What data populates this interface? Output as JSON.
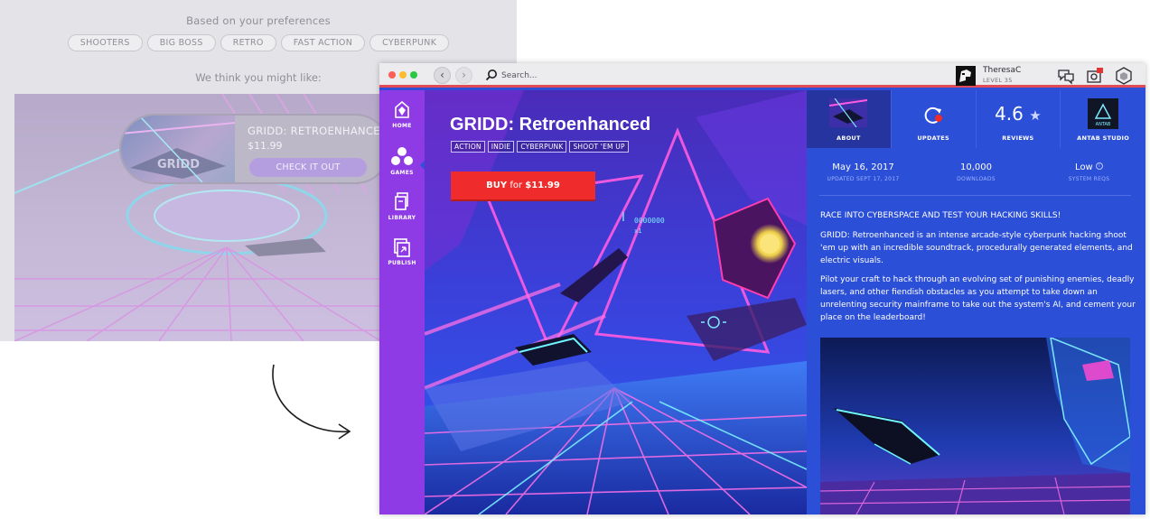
{
  "recommendations": {
    "heading": "Based on your preferences",
    "preferences": [
      "SHOOTERS",
      "BIG BOSS",
      "RETRO",
      "FAST ACTION",
      "CYBERPUNK"
    ],
    "subheading": "We think you might like:",
    "card": {
      "title": "GRIDD: RETROENHANCED",
      "price": "$11.99",
      "button": "CHECK IT OUT"
    }
  },
  "window": {
    "search_placeholder": "Search...",
    "user": {
      "name": "TheresaC",
      "level": "LEVEL 35"
    },
    "icons": [
      "chat-icon",
      "notifications-icon",
      "settings-cube-icon"
    ]
  },
  "sidebar": {
    "items": [
      {
        "label": "HOME",
        "icon": "home-icon"
      },
      {
        "label": "GAMES",
        "icon": "games-icon",
        "active": true
      },
      {
        "label": "LIBRARY",
        "icon": "library-icon"
      },
      {
        "label": "PUBLISH",
        "icon": "publish-icon"
      }
    ]
  },
  "game": {
    "title": "GRIDD: Retroenhanced",
    "tags": [
      "ACTION",
      "INDIE",
      "CYBERPUNK",
      "SHOOT 'EM UP"
    ],
    "buy": {
      "prefix": "BUY",
      "word": "for",
      "price": "$11.99"
    }
  },
  "info": {
    "tabs": {
      "about": "ABOUT",
      "updates": "UPDATES",
      "reviews": "REVIEWS",
      "rating": "4.6",
      "studio": "ANTAB STUDIO",
      "studio_logo_text": "ANTAB"
    },
    "stats": {
      "release_date": "May 16, 2017",
      "updated": "UPDATED SEPT 17, 2017",
      "downloads": "10,000",
      "downloads_label": "DOWNLOADS",
      "reqs": "Low",
      "reqs_label": "SYSTEM REQS"
    },
    "tagline": "RACE INTO CYBERSPACE AND TEST YOUR HACKING SKILLS!",
    "paragraph1": "GRIDD: Retroenhanced is an intense arcade-style cyberpunk hacking shoot 'em up with an incredible soundtrack, procedurally generated elements, and electric visuals.",
    "paragraph2": "Pilot your craft to hack through an evolving set of punishing enemies, deadly lasers, and other fiendish obstacles as you attempt to take down an unrelenting security mainframe to take out the system's AI, and cement your place on the leaderboard!"
  },
  "hud": {
    "counter": "0000000",
    "multiplier": "x1"
  },
  "colors": {
    "accent_purple": "#8e3be6",
    "window_blue": "#2f4fd8",
    "buy_red": "#ef2b2b",
    "titlebar_line": "#e24a56"
  }
}
